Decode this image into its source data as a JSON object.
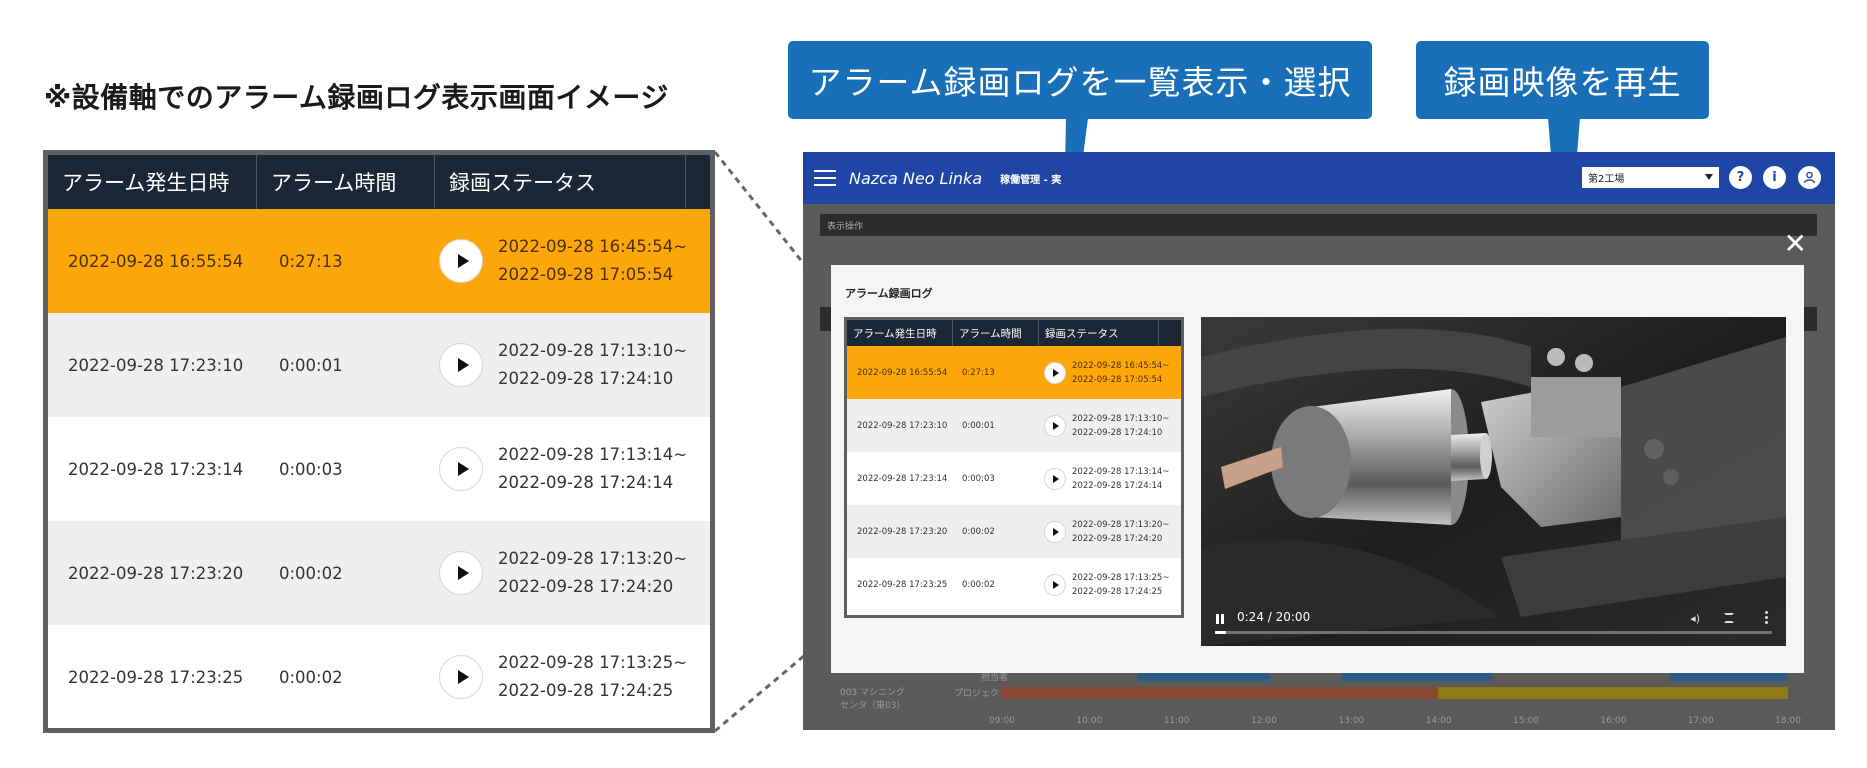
{
  "heading": "※設備軸でのアラーム録画ログ表示画面イメージ",
  "callouts": {
    "list": "アラーム録画ログを一覧表示・選択",
    "play": "録画映像を再生"
  },
  "table": {
    "headers": [
      "アラーム発生日時",
      "アラーム時間",
      "録画ステータス"
    ],
    "rows": [
      {
        "datetime": "2022-09-28 16:55:54",
        "duration": "0:27:13",
        "start": "2022-09-28 16:45:54~",
        "end": "2022-09-28 17:05:54",
        "selected": true
      },
      {
        "datetime": "2022-09-28 17:23:10",
        "duration": "0:00:01",
        "start": "2022-09-28 17:13:10~",
        "end": "2022-09-28 17:24:10",
        "selected": false
      },
      {
        "datetime": "2022-09-28 17:23:14",
        "duration": "0:00:03",
        "start": "2022-09-28 17:13:14~",
        "end": "2022-09-28 17:24:14",
        "selected": false
      },
      {
        "datetime": "2022-09-28 17:23:20",
        "duration": "0:00:02",
        "start": "2022-09-28 17:13:20~",
        "end": "2022-09-28 17:24:20",
        "selected": false
      },
      {
        "datetime": "2022-09-28 17:23:25",
        "duration": "0:00:02",
        "start": "2022-09-28 17:13:25~",
        "end": "2022-09-28 17:24:25",
        "selected": false
      }
    ]
  },
  "app": {
    "brand": "Nazca Neo Linka",
    "breadcrumb": "稼働管理 - 実",
    "factory": "第2工場",
    "help_label": "?",
    "info_label": "i",
    "panel_label": "表示操作",
    "machine_caption_1": "003 マシニング",
    "machine_caption_2": "センタ（東03）",
    "row_label_owner": "担当者",
    "row_label_project": "プロジェクト",
    "timeline_ticks": [
      "09:00",
      "10:00",
      "11:00",
      "12:00",
      "13:00",
      "14:00",
      "15:00",
      "16:00",
      "17:00",
      "18:00"
    ],
    "colors": {
      "topbar": "#1f46a7",
      "selected_row": "#fda60a",
      "callout": "#1a70b8"
    }
  },
  "modal": {
    "title": "アラーム録画ログ",
    "close_label": "✕"
  },
  "video": {
    "time": "0:24 / 20:00",
    "progress_fraction": 0.02
  }
}
